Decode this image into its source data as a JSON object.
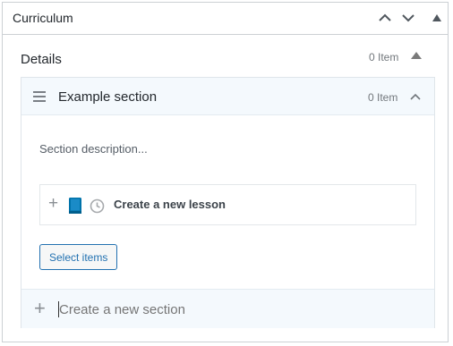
{
  "metabox": {
    "title": "Curriculum"
  },
  "details": {
    "title": "Details",
    "count": "0 Item"
  },
  "section": {
    "title": "Example section",
    "count": "0 Item",
    "description_placeholder": "Section description...",
    "new_lesson_label": "Create a new lesson",
    "select_items_label": "Select items"
  },
  "new_section": {
    "placeholder": "Create a new section"
  },
  "icons": {
    "move_up": "chevron-up-icon",
    "move_down": "chevron-down-icon",
    "toggle": "triangle-up-icon",
    "drag": "drag-handle-icon",
    "lesson": "book-icon",
    "duration": "clock-icon",
    "add": "plus-icon"
  },
  "colors": {
    "accent": "#2271b1",
    "book": "#0073aa",
    "section_bg": "#f4f9fd"
  }
}
